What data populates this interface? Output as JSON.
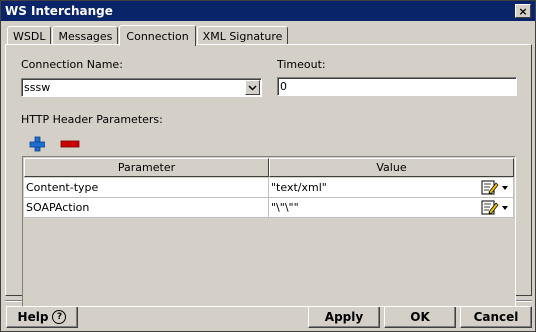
{
  "window": {
    "title": "WS Interchange",
    "close_glyph": "×"
  },
  "tabs": [
    {
      "label": "WSDL"
    },
    {
      "label": "Messages"
    },
    {
      "label": "Connection"
    },
    {
      "label": "XML Signature"
    }
  ],
  "connection": {
    "name_label": "Connection Name:",
    "name_value": "sssw",
    "timeout_label": "Timeout:",
    "timeout_value": "0",
    "headers_label": "HTTP Header Parameters:",
    "add_icon": "plus-icon",
    "remove_icon": "minus-icon"
  },
  "table": {
    "columns": [
      "Parameter",
      "Value"
    ],
    "rows": [
      {
        "parameter": "Content-type",
        "value": "\"text/xml\""
      },
      {
        "parameter": "SOAPAction",
        "value": "\"\\\"\\\"\""
      }
    ]
  },
  "buttons": {
    "help": "Help",
    "help_glyph": "?",
    "apply": "Apply",
    "ok": "OK",
    "cancel": "Cancel"
  },
  "colors": {
    "titlebar": "#0a246a",
    "face": "#d4d0c8",
    "add": "#1e6fd0",
    "remove": "#cc0000"
  }
}
